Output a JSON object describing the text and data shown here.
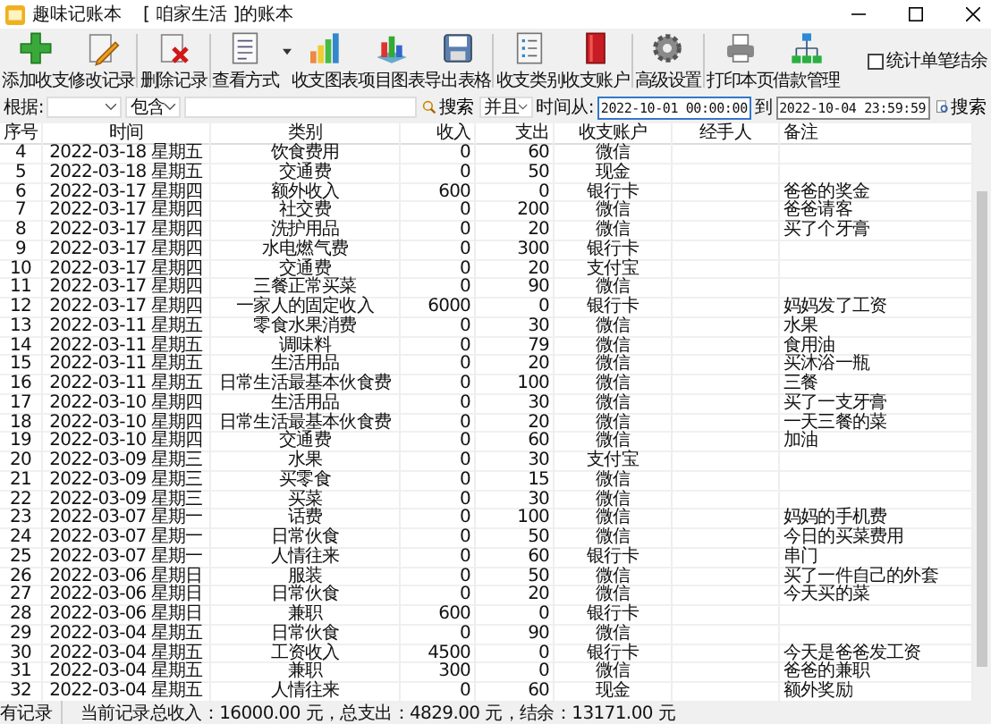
{
  "window": {
    "app_name": "趣味记账本",
    "book_title": "[ 咱家生活 ]的账本"
  },
  "toolbar": [
    {
      "label": "添加收支",
      "kind": "add"
    },
    {
      "label": "修改记录",
      "kind": "edit"
    },
    {
      "label": "删除记录",
      "kind": "delete",
      "group_start": true
    },
    {
      "label": "查看方式",
      "kind": "view",
      "group_start": true,
      "dropdown": true
    },
    {
      "label": "收支图表",
      "kind": "bars"
    },
    {
      "label": "项目图表",
      "kind": "blocks"
    },
    {
      "label": "导出表格",
      "kind": "export"
    },
    {
      "label": "收支类别",
      "kind": "list",
      "group_start": true
    },
    {
      "label": "收支账户",
      "kind": "book"
    },
    {
      "label": "高级设置",
      "kind": "gear",
      "group_start": true
    },
    {
      "label": "打印本页",
      "kind": "print",
      "group_start": true
    },
    {
      "label": "借款管理",
      "kind": "network"
    }
  ],
  "single_balance": {
    "label": "统计单笔结余",
    "checked": false
  },
  "filter": {
    "by_label": "根据:",
    "match": "包含",
    "search_label": "搜索",
    "logic": "并且",
    "from_label": "时间从:",
    "from": "2022-10-01 00:00:00",
    "to_label": "到",
    "to": "2022-10-04 23:59:59",
    "search2_label": "搜索"
  },
  "table": {
    "columns": [
      "序号",
      "时间",
      "类别",
      "收入",
      "支出",
      "收支账户",
      "经手人",
      "备注"
    ],
    "rows": [
      [
        "4",
        "2022-03-18 星期五",
        "饮食费用",
        "0",
        "60",
        "微信",
        "",
        ""
      ],
      [
        "5",
        "2022-03-18 星期五",
        "交通费",
        "0",
        "50",
        "现金",
        "",
        ""
      ],
      [
        "6",
        "2022-03-17 星期四",
        "额外收入",
        "600",
        "0",
        "银行卡",
        "",
        "爸爸的奖金"
      ],
      [
        "7",
        "2022-03-17 星期四",
        "社交费",
        "0",
        "200",
        "微信",
        "",
        "爸爸请客"
      ],
      [
        "8",
        "2022-03-17 星期四",
        "洗护用品",
        "0",
        "20",
        "微信",
        "",
        "买了个牙膏"
      ],
      [
        "9",
        "2022-03-17 星期四",
        "水电燃气费",
        "0",
        "300",
        "银行卡",
        "",
        ""
      ],
      [
        "10",
        "2022-03-17 星期四",
        "交通费",
        "0",
        "20",
        "支付宝",
        "",
        ""
      ],
      [
        "11",
        "2022-03-17 星期四",
        "三餐正常买菜",
        "0",
        "90",
        "微信",
        "",
        ""
      ],
      [
        "12",
        "2022-03-17 星期四",
        "一家人的固定收入",
        "6000",
        "0",
        "银行卡",
        "",
        "妈妈发了工资"
      ],
      [
        "13",
        "2022-03-11 星期五",
        "零食水果消费",
        "0",
        "30",
        "微信",
        "",
        "水果"
      ],
      [
        "14",
        "2022-03-11 星期五",
        "调味料",
        "0",
        "79",
        "微信",
        "",
        "食用油"
      ],
      [
        "15",
        "2022-03-11 星期五",
        "生活用品",
        "0",
        "20",
        "微信",
        "",
        "买沐浴一瓶"
      ],
      [
        "16",
        "2022-03-11 星期五",
        "日常生活最基本伙食费",
        "0",
        "100",
        "微信",
        "",
        "三餐"
      ],
      [
        "17",
        "2022-03-10 星期四",
        "生活用品",
        "0",
        "30",
        "微信",
        "",
        "买了一支牙膏"
      ],
      [
        "18",
        "2022-03-10 星期四",
        "日常生活最基本伙食费",
        "0",
        "20",
        "微信",
        "",
        "一天三餐的菜"
      ],
      [
        "19",
        "2022-03-10 星期四",
        "交通费",
        "0",
        "60",
        "微信",
        "",
        "加油"
      ],
      [
        "20",
        "2022-03-09 星期三",
        "水果",
        "0",
        "30",
        "支付宝",
        "",
        ""
      ],
      [
        "21",
        "2022-03-09 星期三",
        "买零食",
        "0",
        "15",
        "微信",
        "",
        ""
      ],
      [
        "22",
        "2022-03-09 星期三",
        "买菜",
        "0",
        "30",
        "微信",
        "",
        ""
      ],
      [
        "23",
        "2022-03-07 星期一",
        "话费",
        "0",
        "100",
        "微信",
        "",
        "妈妈的手机费"
      ],
      [
        "24",
        "2022-03-07 星期一",
        "日常伙食",
        "0",
        "50",
        "微信",
        "",
        "今日的买菜费用"
      ],
      [
        "25",
        "2022-03-07 星期一",
        "人情往来",
        "0",
        "60",
        "银行卡",
        "",
        "串门"
      ],
      [
        "26",
        "2022-03-06 星期日",
        "服装",
        "0",
        "50",
        "微信",
        "",
        "买了一件自己的外套"
      ],
      [
        "27",
        "2022-03-06 星期日",
        "日常伙食",
        "0",
        "20",
        "微信",
        "",
        "今天买的菜"
      ],
      [
        "28",
        "2022-03-06 星期日",
        "兼职",
        "600",
        "0",
        "银行卡",
        "",
        ""
      ],
      [
        "29",
        "2022-03-04 星期五",
        "日常伙食",
        "0",
        "90",
        "微信",
        "",
        ""
      ],
      [
        "30",
        "2022-03-04 星期五",
        "工资收入",
        "4500",
        "0",
        "银行卡",
        "",
        "今天是爸爸发工资"
      ],
      [
        "31",
        "2022-03-04 星期五",
        "兼职",
        "300",
        "0",
        "微信",
        "",
        "爸爸的兼职"
      ],
      [
        "32",
        "2022-03-04 星期五",
        "人情往来",
        "0",
        "60",
        "现金",
        "",
        "额外奖励"
      ]
    ]
  },
  "status_bar": {
    "scope": "有记录",
    "summary": "当前记录总收入：16000.00 元，总支出：4829.00 元，结余：13171.00 元"
  }
}
